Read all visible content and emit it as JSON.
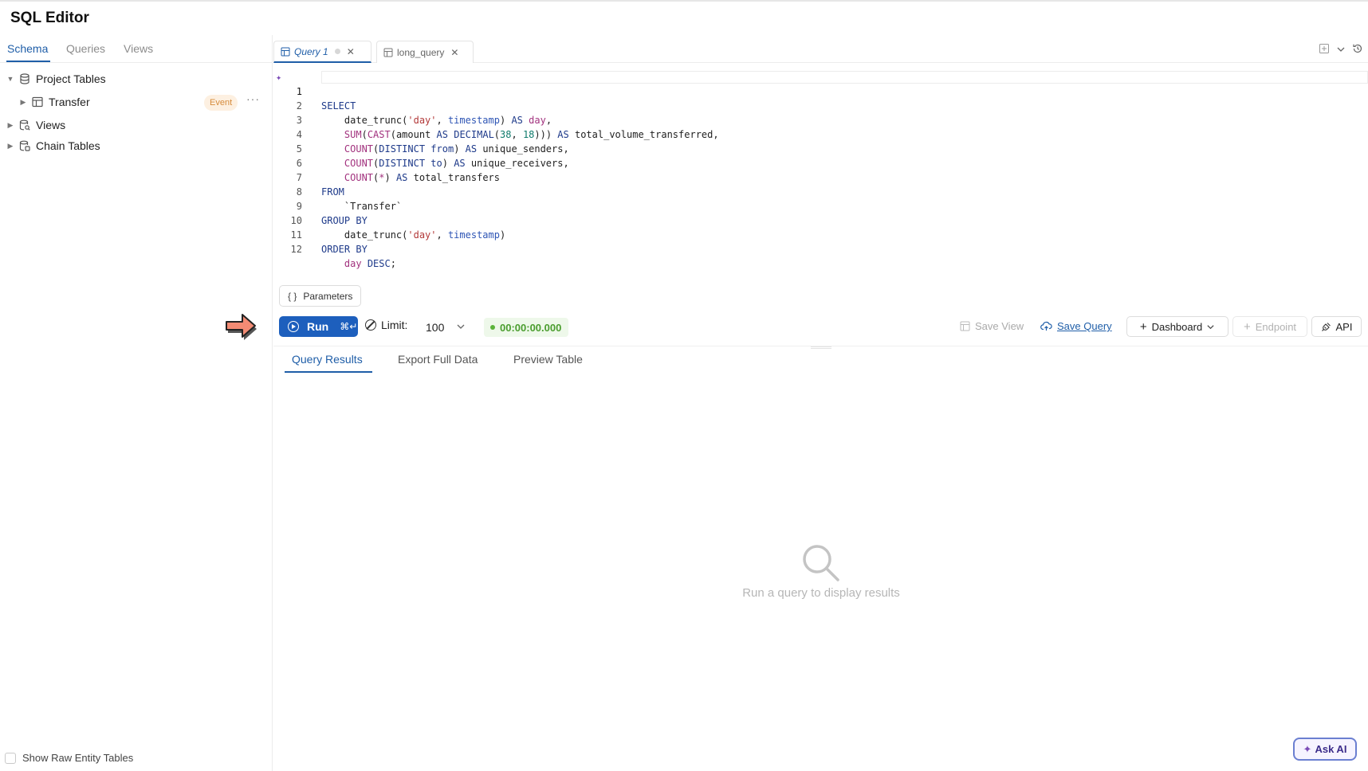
{
  "app": {
    "title": "SQL Editor"
  },
  "left": {
    "tabs": [
      {
        "label": "Schema",
        "active": true
      },
      {
        "label": "Queries",
        "active": false
      },
      {
        "label": "Views",
        "active": false
      }
    ],
    "tree": {
      "project_tables": "Project Tables",
      "transfer": "Transfer",
      "transfer_badge": "Event",
      "views": "Views",
      "chain_tables": "Chain Tables"
    },
    "show_raw_label": "Show Raw Entity Tables"
  },
  "editor": {
    "tabs": [
      {
        "label": "Query 1",
        "active": true
      },
      {
        "label": "long_query",
        "active": false
      }
    ],
    "line_numbers": [
      "1",
      "2",
      "3",
      "4",
      "5",
      "6",
      "7",
      "8",
      "9",
      "10",
      "11",
      "12"
    ]
  },
  "toolbar": {
    "parameters": "Parameters",
    "run": "Run",
    "run_shortcut": "⌘↵",
    "limit_label": "Limit:",
    "limit_value": "100",
    "timer": "00:00:00.000",
    "save_view": "Save View",
    "save_query": "Save Query",
    "dashboard": "Dashboard",
    "endpoint": "Endpoint",
    "api": "API"
  },
  "results": {
    "tabs": [
      {
        "label": "Query Results",
        "active": true
      },
      {
        "label": "Export Full Data",
        "active": false
      },
      {
        "label": "Preview Table",
        "active": false
      }
    ],
    "empty_text": "Run a query to display results"
  },
  "ask_ai": "Ask AI",
  "colors": {
    "accent": "#1d5fbd",
    "badge_bg": "#fdf0e1",
    "badge_text": "#d68b3c",
    "timer_text": "#4a9d2e",
    "arrow": "#f28b74"
  }
}
